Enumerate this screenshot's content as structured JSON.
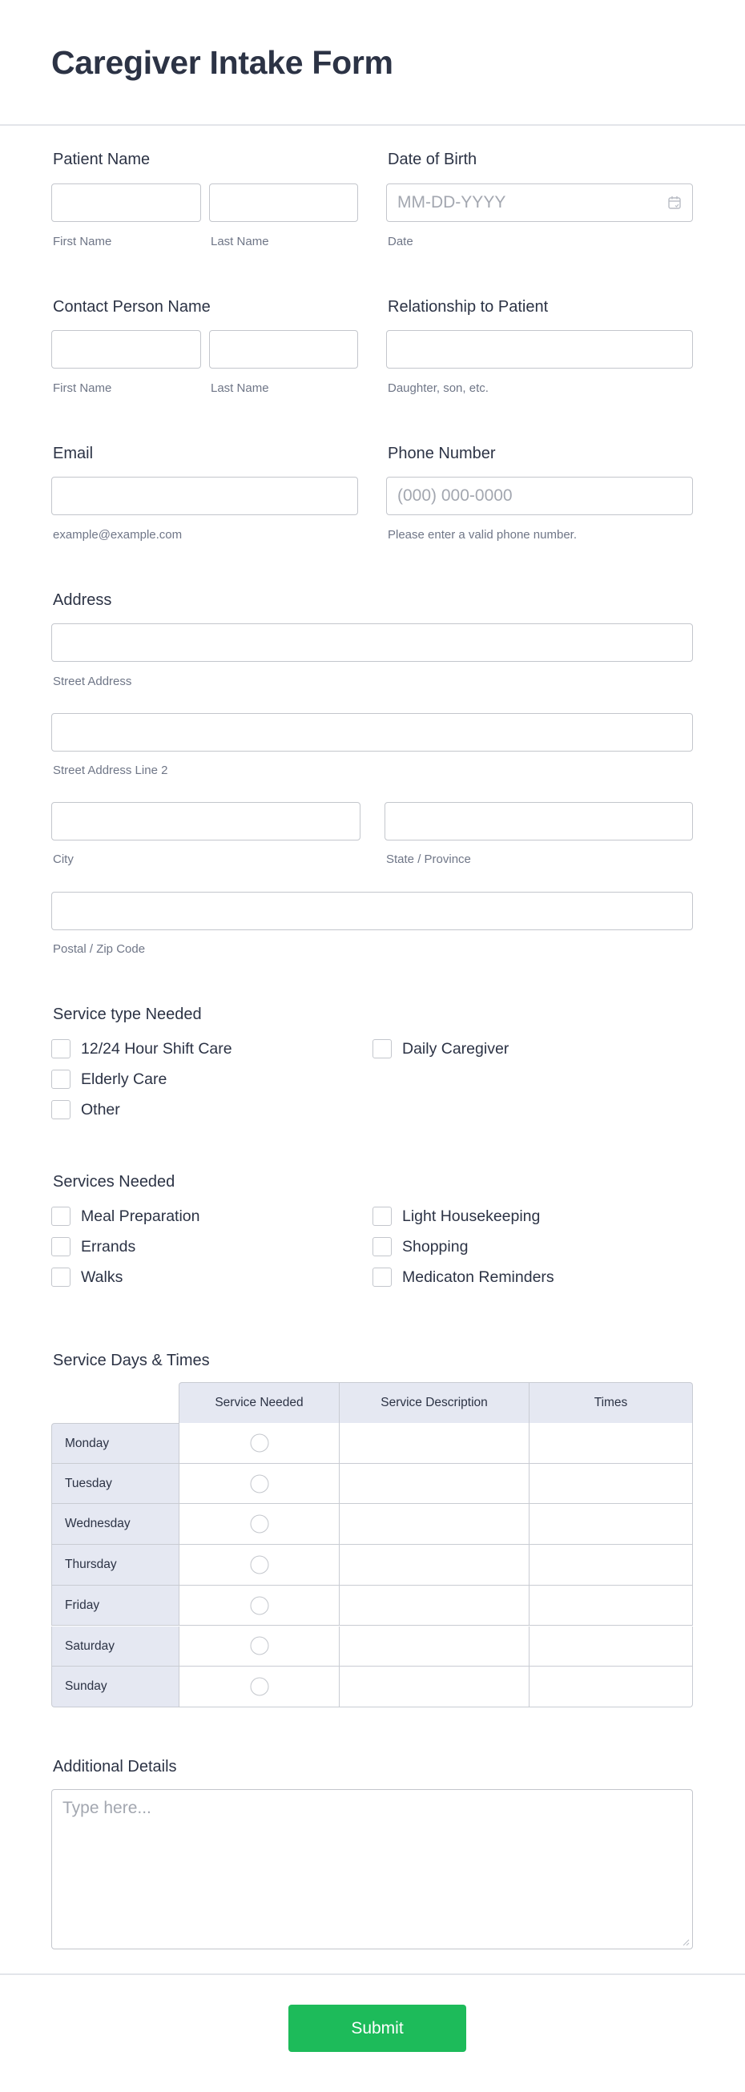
{
  "form": {
    "title": "Caregiver Intake Form"
  },
  "patient_name": {
    "label": "Patient Name",
    "first_sublabel": "First Name",
    "last_sublabel": "Last Name",
    "first_value": "",
    "last_value": ""
  },
  "date_of_birth": {
    "label": "Date of Birth",
    "placeholder": "MM-DD-YYYY",
    "sublabel": "Date",
    "icon": "calendar-icon"
  },
  "contact_person": {
    "label": "Contact Person Name",
    "first_sublabel": "First Name",
    "last_sublabel": "Last Name"
  },
  "relationship": {
    "label": "Relationship to Patient",
    "sublabel": "Daughter, son, etc."
  },
  "email": {
    "label": "Email",
    "sublabel": "example@example.com"
  },
  "phone": {
    "label": "Phone Number",
    "placeholder": "(000) 000-0000",
    "sublabel": "Please enter a valid phone number."
  },
  "address": {
    "label": "Address",
    "street_sublabel": "Street Address",
    "street2_sublabel": "Street Address Line 2",
    "city_sublabel": "City",
    "state_sublabel": "State / Province",
    "postal_sublabel": "Postal / Zip Code"
  },
  "service_type": {
    "label": "Service type Needed",
    "options": [
      {
        "label": "12/24 Hour Shift Care",
        "checked": false
      },
      {
        "label": "Daily Caregiver",
        "checked": false
      },
      {
        "label": "Elderly Care",
        "checked": false
      },
      {
        "label": "Other",
        "checked": false
      }
    ]
  },
  "services_needed": {
    "label": "Services Needed",
    "options": [
      {
        "label": "Meal Preparation",
        "checked": false
      },
      {
        "label": "Light Housekeeping",
        "checked": false
      },
      {
        "label": "Errands",
        "checked": false
      },
      {
        "label": "Shopping",
        "checked": false
      },
      {
        "label": "Walks",
        "checked": false
      },
      {
        "label": "Medicaton Reminders",
        "checked": false
      }
    ]
  },
  "service_days": {
    "label": "Service Days & Times",
    "columns": [
      "Service Needed",
      "Service Description",
      "Times"
    ],
    "rows": [
      "Monday",
      "Tuesday",
      "Wednesday",
      "Thursday",
      "Friday",
      "Saturday",
      "Sunday"
    ]
  },
  "additional_details": {
    "label": "Additional Details",
    "placeholder": "Type here..."
  },
  "submit": {
    "label": "Submit",
    "color": "#1dbb5a"
  }
}
